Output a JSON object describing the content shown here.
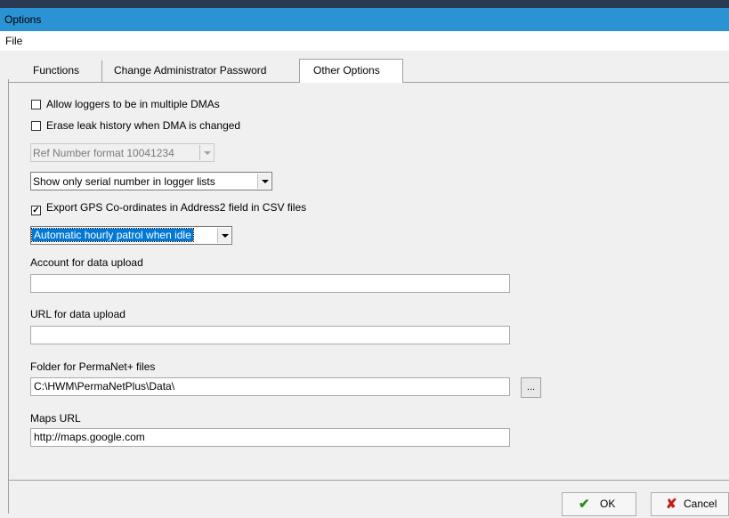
{
  "window": {
    "title": "Options"
  },
  "menu": {
    "file": "File"
  },
  "tabs": [
    {
      "label": "Functions"
    },
    {
      "label": "Change Administrator Password"
    },
    {
      "label": "Other Options"
    }
  ],
  "options": {
    "allow_multiple_dmas": {
      "label": "Allow loggers to be in multiple DMAs",
      "checked": false
    },
    "erase_leak_history": {
      "label": "Erase leak history when DMA is changed",
      "checked": false
    },
    "ref_number_format": {
      "value": "Ref Number format 10041234",
      "disabled": true
    },
    "logger_list_display": {
      "value": "Show only serial number in logger lists"
    },
    "export_gps": {
      "label": "Export GPS Co-ordinates in Address2 field in CSV files",
      "checked": true,
      "mark": "✓"
    },
    "patrol_mode": {
      "value": "Automatic hourly patrol when idle"
    }
  },
  "fields": {
    "account_upload": {
      "label": "Account for data upload",
      "value": ""
    },
    "url_upload": {
      "label": "URL for data upload",
      "value": ""
    },
    "permanet_folder": {
      "label": "Folder for PermaNet+ files",
      "value": "C:\\HWM\\PermaNetPlus\\Data\\",
      "browse_label": "..."
    },
    "maps_url": {
      "label": "Maps URL",
      "value": "http://maps.google.com"
    }
  },
  "buttons": {
    "ok": {
      "label": "OK",
      "icon": "checkmark-icon",
      "glyph": "✔",
      "color": "#2e8b20"
    },
    "cancel": {
      "label": "Cancel",
      "icon": "x-icon",
      "glyph": "✘",
      "color": "#c0201a"
    }
  },
  "colors": {
    "titlebar": "#2b92d3",
    "selection": "#0078d7"
  }
}
